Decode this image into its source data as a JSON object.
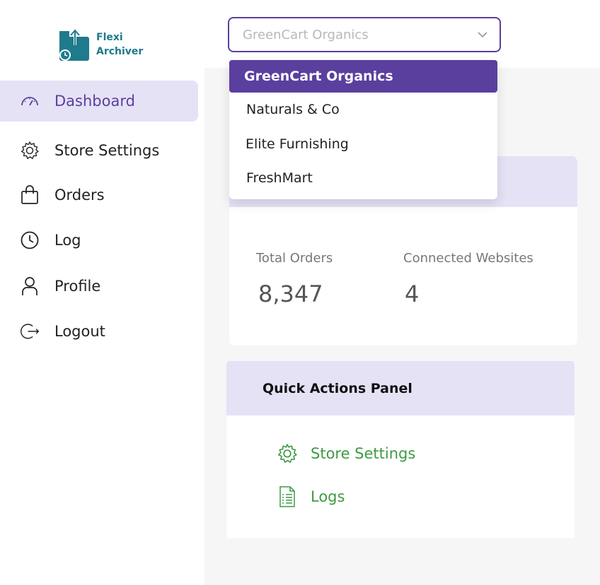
{
  "brand": {
    "line1": "Flexi",
    "line2": "Archiver"
  },
  "sidebar": {
    "items": [
      {
        "label": "Dashboard",
        "icon": "gauge-icon",
        "active": true
      },
      {
        "label": "Store Settings",
        "icon": "gear-icon"
      },
      {
        "label": "Orders",
        "icon": "shopping-bag-icon"
      },
      {
        "label": "Log",
        "icon": "clock-icon"
      },
      {
        "label": "Profile",
        "icon": "user-icon"
      },
      {
        "label": "Logout",
        "icon": "logout-icon"
      }
    ]
  },
  "store_select": {
    "value": "GreenCart Organics",
    "options": [
      "GreenCart Organics",
      "Naturals & Co",
      "Elite Furnishing",
      "FreshMart"
    ]
  },
  "stats": {
    "total_orders_label": "Total Orders",
    "total_orders_value": "8,347",
    "connected_label": "Connected Websites",
    "connected_value": "4"
  },
  "quick_actions": {
    "title": "Quick Actions Panel",
    "items": [
      {
        "label": "Store Settings",
        "icon": "gear-icon"
      },
      {
        "label": "Logs",
        "icon": "document-list-icon"
      }
    ]
  },
  "colors": {
    "accent": "#5b3f9e",
    "accent_light": "#e6e2f6",
    "action_green": "#3e9a45",
    "brand_teal": "#1f7a8c"
  }
}
